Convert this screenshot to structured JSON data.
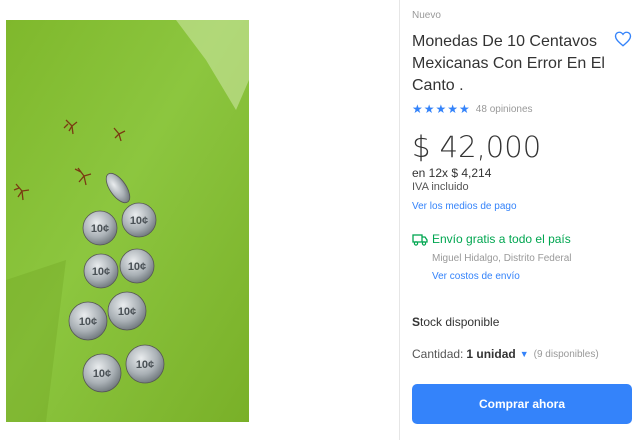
{
  "product": {
    "condition": "Nuevo",
    "title": "Monedas De 10 Centavos Mexicanas Con Error En El Canto .",
    "rating": {
      "stars": 5,
      "reviews_label": "48 opiniones"
    },
    "price": "$ 42,000",
    "installments": "en 12x $ 4,214",
    "tax_note": "IVA incluido",
    "payment_link": "Ver los medios de pago"
  },
  "shipping": {
    "text": "Envío gratis a todo el país",
    "location": "Miguel Hidalgo, Distrito Federal",
    "costs_link": "Ver costos de envío"
  },
  "stock": {
    "prefix": "S",
    "rest": "tock disponible"
  },
  "quantity": {
    "label": "Cantidad:",
    "value": "1 unidad",
    "available": "(9 disponibles)"
  },
  "actions": {
    "buy_label": "Comprar ahora"
  },
  "icons": {
    "favorite": "heart-icon",
    "shipping": "truck-icon",
    "dropdown": "chevron-down-icon",
    "star": "star-icon"
  },
  "colors": {
    "accent": "#3483fa",
    "shipping_green": "#00a650",
    "photo_green": "#8cc63f"
  }
}
